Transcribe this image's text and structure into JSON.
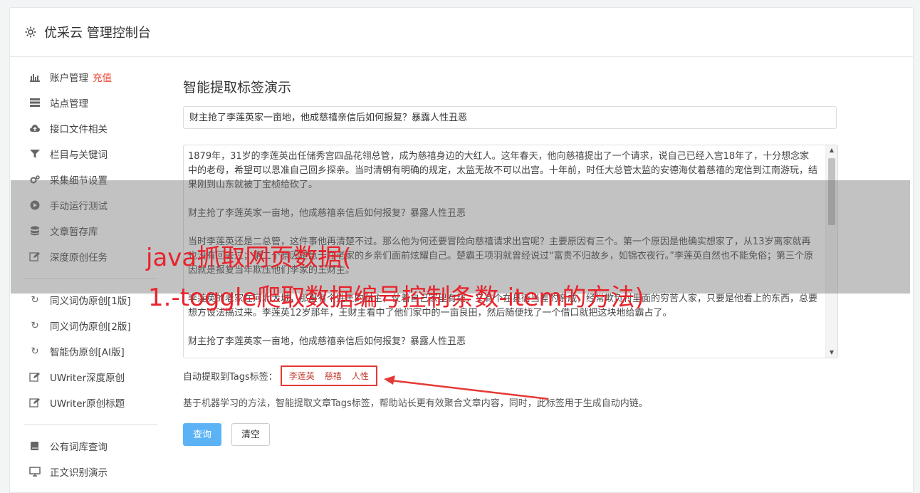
{
  "header": {
    "title": "优采云 管理控制台",
    "icon": "gear-icon"
  },
  "sidebar": {
    "groups": [
      {
        "items": [
          {
            "label": "账户管理",
            "badge": "充值",
            "icon": "bar-chart-icon"
          },
          {
            "label": "站点管理",
            "icon": "server-icon"
          },
          {
            "label": "接口文件相关",
            "icon": "cloud-upload-icon"
          },
          {
            "label": "栏目与关键词",
            "icon": "filter-icon"
          },
          {
            "label": "采集细节设置",
            "icon": "gears-icon"
          },
          {
            "label": "手动运行测试",
            "icon": "play-icon"
          },
          {
            "label": "文章暂存库",
            "icon": "database-icon"
          },
          {
            "label": "深度原创任务",
            "icon": "edit-icon"
          }
        ]
      },
      {
        "items": [
          {
            "label": "同义词伪原创[1版]",
            "icon": "refresh-icon"
          },
          {
            "label": "同义词伪原创[2版]",
            "icon": "refresh-icon"
          },
          {
            "label": "智能伪原创[AI版]",
            "icon": "refresh-icon"
          },
          {
            "label": "UWriter深度原创",
            "icon": "edit-icon"
          },
          {
            "label": "UWriter原创标题",
            "icon": "edit-icon"
          }
        ]
      },
      {
        "items": [
          {
            "label": "公有词库查询",
            "icon": "book-icon"
          },
          {
            "label": "正文识别演示",
            "icon": "monitor-icon"
          }
        ]
      }
    ]
  },
  "main": {
    "heading": "智能提取标签演示",
    "title_value": "财主抢了李莲英家一亩地，他成慈禧亲信后如何报复？暴露人性丑恶",
    "content_paragraphs": [
      "1879年，31岁的李莲英出任储秀宫四品花翎总管，成为慈禧身边的大红人。这年春天，他向慈禧提出了一个请求，说自己已经入宫18年了，十分想念家中的老母，希望可以恩准自己回乡探亲。当时清朝有明确的规定，太监无故不可以出宫。十年前，时任大总管太监的安德海仗着慈禧的宠信到江南游玩，结果刚到山东就被丁宝桢给砍了。",
      "财主抢了李莲英家一亩地，他成慈禧亲信后如何报复？暴露人性丑恶",
      "当时李莲英还是二总管，这件事他再清楚不过。那么他为何还要冒险向慈禧请求出宫呢？主要原因有三个。第一个原因是他确实想家了，从13岁离家就再也没有回去过；第二个原因是急于在老家的乡亲们面前炫耀自己。楚霸王项羽就曾经说过“富贵不归故乡，如锦衣夜行。”李莲英自然也不能免俗；第三个原因就是报复当年欺压他们李家的王财主。",
      "李莲英的老家在河北大城，那里有个姓王的财主，仗着自己家里有钱，又有个在县衙当差的亲戚，经常欺负村里面的穷苦人家，只要是他看上的东西，总要想方设法搞过来。李莲英12岁那年，王财主看中了他们家中的一亩良田，然后随便找了一个借口就把这块地给霸占了。",
      "财主抢了李莲英家一亩地，他成慈禧亲信后如何报复？暴露人性丑恶"
    ],
    "tags_label": "自动提取到Tags标签：",
    "tags": [
      "李莲英",
      "慈禧",
      "人性"
    ],
    "description": "基于机器学习的方法，智能提取文章Tags标签，帮助站长更有效聚合文章内容，同时，此标签用于生成自动内链。",
    "query_button": "查询",
    "clear_button": "清空"
  },
  "overlay": {
    "line1": "java抓取网页数据(",
    "line2": "1.-toggle爬取数据编号控制条数-item的方法)",
    "color": "#e8232b"
  }
}
